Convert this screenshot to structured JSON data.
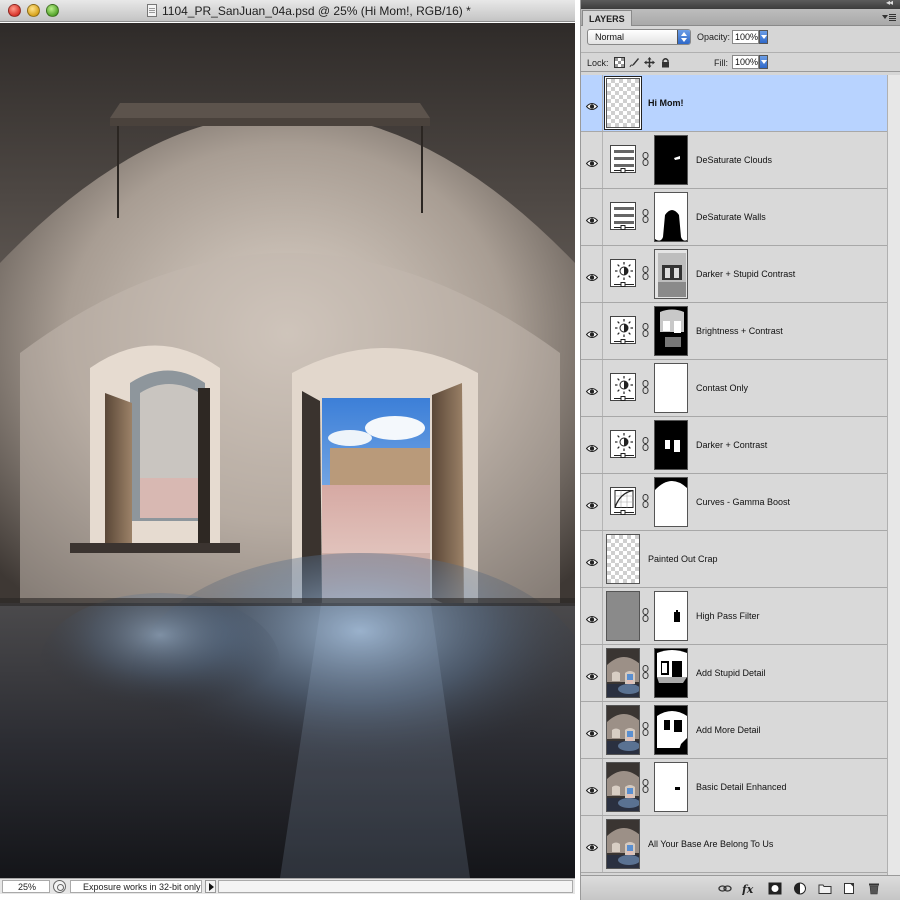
{
  "document": {
    "title": "1104_PR_SanJuan_04a.psd @ 25% (Hi Mom!, RGB/16) *",
    "zoom": "25%",
    "status_text": "Exposure works in 32-bit only"
  },
  "panel": {
    "tab_label": "LAYERS",
    "blend_mode": "Normal",
    "opacity_label": "Opacity:",
    "opacity_value": "100%",
    "lock_label": "Lock:",
    "fill_label": "Fill:",
    "fill_value": "100%"
  },
  "layers": [
    {
      "name": "Hi Mom!",
      "kind": "transparent",
      "selected": true,
      "visible": true,
      "has_mask": false
    },
    {
      "name": "DeSaturate Clouds",
      "kind": "hue-saturation",
      "visible": true,
      "has_mask": true,
      "mask": "clouds"
    },
    {
      "name": "DeSaturate Walls",
      "kind": "hue-saturation",
      "visible": true,
      "has_mask": true,
      "mask": "walls"
    },
    {
      "name": "Darker + Stupid Contrast",
      "kind": "brightness-contrast",
      "visible": true,
      "has_mask": true,
      "mask": "detail-gray"
    },
    {
      "name": "Brightness + Contrast",
      "kind": "brightness-contrast",
      "visible": true,
      "has_mask": true,
      "mask": "bright-detail"
    },
    {
      "name": "Contast Only",
      "kind": "brightness-contrast",
      "visible": true,
      "has_mask": true,
      "mask": "white"
    },
    {
      "name": "Darker + Contrast",
      "kind": "brightness-contrast",
      "visible": true,
      "has_mask": true,
      "mask": "doors"
    },
    {
      "name": "Curves - Gamma Boost",
      "kind": "curves",
      "visible": true,
      "has_mask": true,
      "mask": "vault"
    },
    {
      "name": "Painted Out Crap",
      "kind": "transparent",
      "visible": true,
      "has_mask": false
    },
    {
      "name": "High Pass Filter",
      "kind": "gray",
      "visible": true,
      "has_mask": true,
      "mask": "white-doors"
    },
    {
      "name": "Add Stupid Detail",
      "kind": "photo",
      "visible": true,
      "has_mask": true,
      "mask": "stupid-detail"
    },
    {
      "name": "Add More Detail",
      "kind": "photo",
      "visible": true,
      "has_mask": true,
      "mask": "more-detail"
    },
    {
      "name": "Basic Detail Enhanced",
      "kind": "photo",
      "visible": true,
      "has_mask": true,
      "mask": "white-dot"
    },
    {
      "name": "All Your Base Are Belong To Us",
      "kind": "photo",
      "visible": true,
      "has_mask": false
    }
  ],
  "icons": {
    "eye": "eye-icon",
    "link": "chain-link-icon",
    "bottom_buttons": [
      "link-layers-icon",
      "fx-icon",
      "add-mask-icon",
      "adjustment-layer-icon",
      "new-group-icon",
      "new-layer-icon",
      "trash-icon"
    ]
  },
  "colors": {
    "selected_row": "#b8d3ff",
    "panel_bg": "#d6d6d6",
    "dropdown_accent": "#2e68c9"
  }
}
